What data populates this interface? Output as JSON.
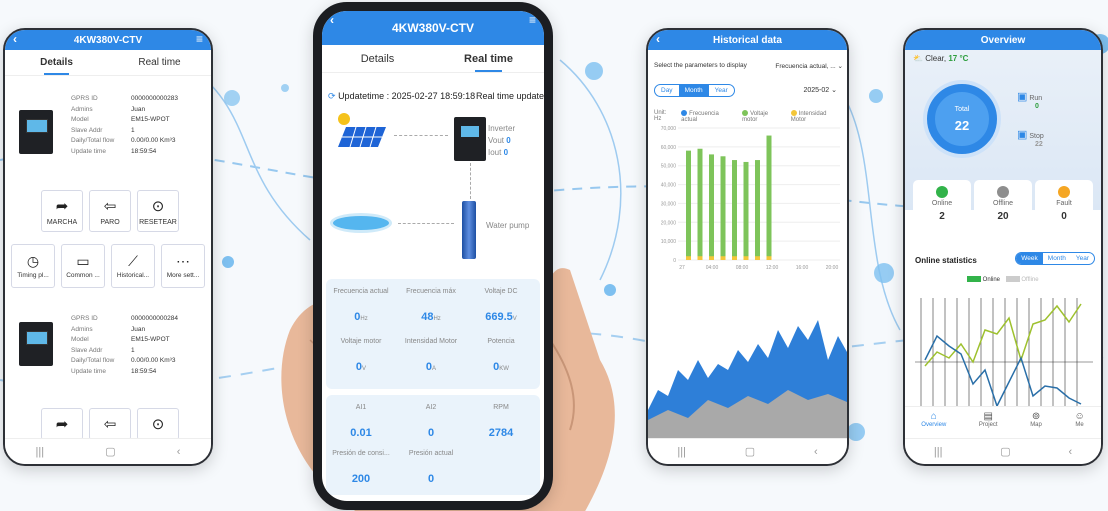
{
  "colors": {
    "accent": "#2e88e6",
    "green": "#7ec45a",
    "yellow": "#f3c63a"
  },
  "phone1": {
    "title": "4KW380V-CTV",
    "tab_details": "Details",
    "tab_realtime": "Real time",
    "devices": [
      {
        "fields": [
          [
            "GPRS ID",
            "0000000000283"
          ],
          [
            "Admins",
            "Juan"
          ],
          [
            "Model",
            "EM15-WPOT"
          ],
          [
            "Slave Addr",
            "1"
          ],
          [
            "Daily/Total flow",
            "0.00/0.00 Km³3"
          ],
          [
            "Update time",
            "18:59:54"
          ]
        ]
      },
      {
        "fields": [
          [
            "GPRS ID",
            "0000000000284"
          ],
          [
            "Admins",
            "Juan"
          ],
          [
            "Model",
            "EM15-WPOT"
          ],
          [
            "Slave Addr",
            "1"
          ],
          [
            "Daily/Total flow",
            "0.00/0.00 Km³3"
          ],
          [
            "Update time",
            "18:59:54"
          ]
        ]
      }
    ],
    "buttons": {
      "marcha": "MARCHA",
      "paro": "PARO",
      "resetear": "RESETEAR"
    },
    "tools": {
      "timing": "Timing pl...",
      "common": "Common ...",
      "historical": "Historical...",
      "more": "More sett..."
    }
  },
  "phone2": {
    "title": "4KW380V-CTV",
    "tab_details": "Details",
    "tab_realtime": "Real time",
    "updatetime": "Updatetime : 2025-02-27 18:59:18",
    "rt_update": "Real time update",
    "inverter": "Inverter",
    "vout": "Vout",
    "vout_val": "0",
    "iout": "Iout",
    "iout_val": "0",
    "water_pump": "Water pump",
    "cells": [
      {
        "label": "Frecuencia actual",
        "value": "0",
        "unit": "Hz"
      },
      {
        "label": "Frecuencia máx",
        "value": "48",
        "unit": "Hz"
      },
      {
        "label": "Voltaje DC",
        "value": "669.5",
        "unit": "V"
      },
      {
        "label": "Voltaje motor",
        "value": "0",
        "unit": "V"
      },
      {
        "label": "Intensidad Motor",
        "value": "0",
        "unit": "A"
      },
      {
        "label": "Potencia",
        "value": "0",
        "unit": "KW"
      },
      {
        "label": "AI1",
        "value": "0.01",
        "unit": ""
      },
      {
        "label": "AI2",
        "value": "0",
        "unit": ""
      },
      {
        "label": "RPM",
        "value": "2784",
        "unit": ""
      },
      {
        "label": "Presión de consi...",
        "value": "200",
        "unit": ""
      },
      {
        "label": "Presión actual",
        "value": "0",
        "unit": ""
      }
    ]
  },
  "phone3": {
    "title": "Historical data",
    "select_label": "Select the parameters to display",
    "select_value": "Frecuencia actual, ...",
    "seg": [
      "Day",
      "Month",
      "Year"
    ],
    "date": "2025-02",
    "unit_label": "Unit: Hz",
    "legend": [
      "Frecuencia actual",
      "Voltaje motor",
      "Intensidad Motor"
    ],
    "chart_data": {
      "type": "bar",
      "title": "",
      "y_ticks": [
        "70,000",
        "60,000",
        "50,000",
        "40,000",
        "30,000",
        "20,000",
        "10,000",
        "0"
      ],
      "x_ticks": [
        "27",
        "04:00",
        "08:00",
        "12:00",
        "16:00",
        "20:00"
      ],
      "ylim": [
        0,
        70000
      ],
      "series": [
        {
          "name": "Voltaje motor",
          "values": [
            58000,
            59000,
            56000,
            55000,
            53000,
            52000,
            53000,
            66000
          ]
        },
        {
          "name": "Intensidad Motor",
          "values": [
            2000,
            2000,
            2000,
            2000,
            2000,
            2000,
            2000,
            2000
          ]
        }
      ]
    }
  },
  "phone4": {
    "title": "Overview",
    "weather": "Clear,",
    "temp": "17 °C",
    "total_label": "Total",
    "total": "22",
    "run_label": "Run",
    "run": "0",
    "stop_label": "Stop",
    "stop": "22",
    "online_label": "Online",
    "online": "2",
    "offline_label": "Offline",
    "offline": "20",
    "fault_label": "Fault",
    "fault": "0",
    "stats_title": "Online statistics",
    "seg": [
      "Week",
      "Month",
      "Year"
    ],
    "legend_online": "Online",
    "legend_offline": "Offline",
    "tabs": [
      "Overview",
      "Project",
      "Map",
      "Me"
    ]
  }
}
